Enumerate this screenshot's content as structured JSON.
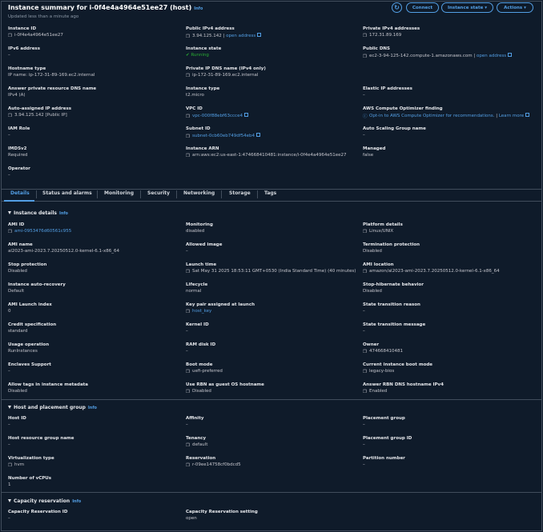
{
  "header": {
    "title": "Instance summary for i-0f4e4a4964e51ee27 (host)",
    "info": "Info",
    "updated": "Updated less than a minute ago",
    "connect": "Connect",
    "instance_state": "Instance state",
    "actions": "Actions"
  },
  "summary": {
    "instance_id_label": "Instance ID",
    "instance_id": "i-0f4e4a4964e51ee27",
    "ipv6_label": "IPv6 address",
    "ipv6": "–",
    "hostname_type_label": "Hostname type",
    "hostname_type": "IP name: ip-172-31-89-169.ec2.internal",
    "answer_dns_label": "Answer private resource DNS name",
    "answer_dns": "IPv4 (A)",
    "auto_ip_label": "Auto-assigned IP address",
    "auto_ip": "3.94.125.142 [Public IP]",
    "iam_role_label": "IAM Role",
    "iam_role": "–",
    "imdsv2_label": "IMDSv2",
    "imdsv2": "Required",
    "operator_label": "Operator",
    "operator": "–",
    "public_ipv4_label": "Public IPv4 address",
    "public_ipv4": "3.94.125.142",
    "open_address": "open address",
    "instance_state_label": "Instance state",
    "instance_state": "Running",
    "private_ip_dns_label": "Private IP DNS name (IPv4 only)",
    "private_ip_dns": "ip-172-31-89-169.ec2.internal",
    "instance_type_label": "Instance type",
    "instance_type": "t2.micro",
    "vpc_label": "VPC ID",
    "vpc": "vpc-000f88ebf63ccce4",
    "subnet_label": "Subnet ID",
    "subnet": "subnet-0cb60eb749df54eb4",
    "arn_label": "Instance ARN",
    "arn": "arn:aws:ec2:us-east-1:474668410481:instance/i-0f4e4a4964e51ee27",
    "private_ipv4_label": "Private IPv4 addresses",
    "private_ipv4": "172.31.89.169",
    "public_dns_label": "Public DNS",
    "public_dns": "ec2-3-94-125-142.compute-1.amazonaws.com",
    "elastic_ip_label": "Elastic IP addresses",
    "elastic_ip": "–",
    "optimizer_label": "AWS Compute Optimizer finding",
    "optimizer": "Opt-in to AWS Compute Optimizer for recommendations.",
    "learn_more": "Learn more",
    "asg_label": "Auto Scaling Group name",
    "asg": "–",
    "managed_label": "Managed",
    "managed": "false"
  },
  "tabs": [
    "Details",
    "Status and alarms",
    "Monitoring",
    "Security",
    "Networking",
    "Storage",
    "Tags"
  ],
  "details": {
    "title": "Instance details",
    "info": "Info",
    "ami_id_label": "AMI ID",
    "ami_id": "ami-0953476d60561c955",
    "ami_name_label": "AMI name",
    "ami_name": "al2023-ami-2023.7.20250512.0-kernel-6.1-x86_64",
    "stop_prot_label": "Stop protection",
    "stop_prot": "Disabled",
    "auto_recovery_label": "Instance auto-recovery",
    "auto_recovery": "Default",
    "ami_launch_label": "AMI Launch index",
    "ami_launch": "0",
    "credit_label": "Credit specification",
    "credit": "standard",
    "usage_label": "Usage operation",
    "usage": "RunInstances",
    "enclaves_label": "Enclaves Support",
    "enclaves": "–",
    "allow_tags_label": "Allow tags in instance metadata",
    "allow_tags": "Disabled",
    "monitoring_label": "Monitoring",
    "monitoring": "disabled",
    "allowed_image_label": "Allowed image",
    "allowed_image": "–",
    "launch_time_label": "Launch time",
    "launch_time": "Sat May 31 2025 18:53:11 GMT+0530 (India Standard Time) (40 minutes)",
    "lifecycle_label": "Lifecycle",
    "lifecycle": "normal",
    "keypair_label": "Key pair assigned at launch",
    "keypair": "host_key",
    "kernel_label": "Kernel ID",
    "kernel": "–",
    "ramdisk_label": "RAM disk ID",
    "ramdisk": "–",
    "boot_mode_label": "Boot mode",
    "boot_mode": "uefi-preferred",
    "rbn_label": "Use RBN as guest OS hostname",
    "rbn": "Disabled",
    "platform_label": "Platform details",
    "platform": "Linux/UNIX",
    "termination_label": "Termination protection",
    "termination": "Disabled",
    "ami_location_label": "AMI location",
    "ami_location": "amazon/al2023-ami-2023.7.20250512.0-kernel-6.1-x86_64",
    "stop_hibernate_label": "Stop-hibernate behavior",
    "stop_hibernate": "Disabled",
    "state_reason_label": "State transition reason",
    "state_reason": "–",
    "state_msg_label": "State transition message",
    "state_msg": "–",
    "owner_label": "Owner",
    "owner": "474668410481",
    "current_boot_label": "Current instance boot mode",
    "current_boot": "legacy-bios",
    "answer_rbn_label": "Answer RBN DNS hostname IPv4",
    "answer_rbn": "Enabled"
  },
  "host": {
    "title": "Host and placement group",
    "info": "Info",
    "host_id_label": "Host ID",
    "host_id": "–",
    "host_rg_label": "Host resource group name",
    "host_rg": "–",
    "virt_label": "Virtualization type",
    "virt": "hvm",
    "vcpus_label": "Number of vCPUs",
    "vcpus": "1",
    "affinity_label": "Affinity",
    "affinity": "–",
    "tenancy_label": "Tenancy",
    "tenancy": "default",
    "reservation_label": "Reservation",
    "reservation": "r-09ee14758cf0bdcd5",
    "pg_label": "Placement group",
    "pg": "–",
    "pg_id_label": "Placement group ID",
    "pg_id": "–",
    "partition_label": "Partition number",
    "partition": "–"
  },
  "capacity": {
    "title": "Capacity reservation",
    "info": "Info",
    "cr_id_label": "Capacity Reservation ID",
    "cr_id": "–",
    "cr_setting_label": "Capacity Reservation setting",
    "cr_setting": "open"
  }
}
